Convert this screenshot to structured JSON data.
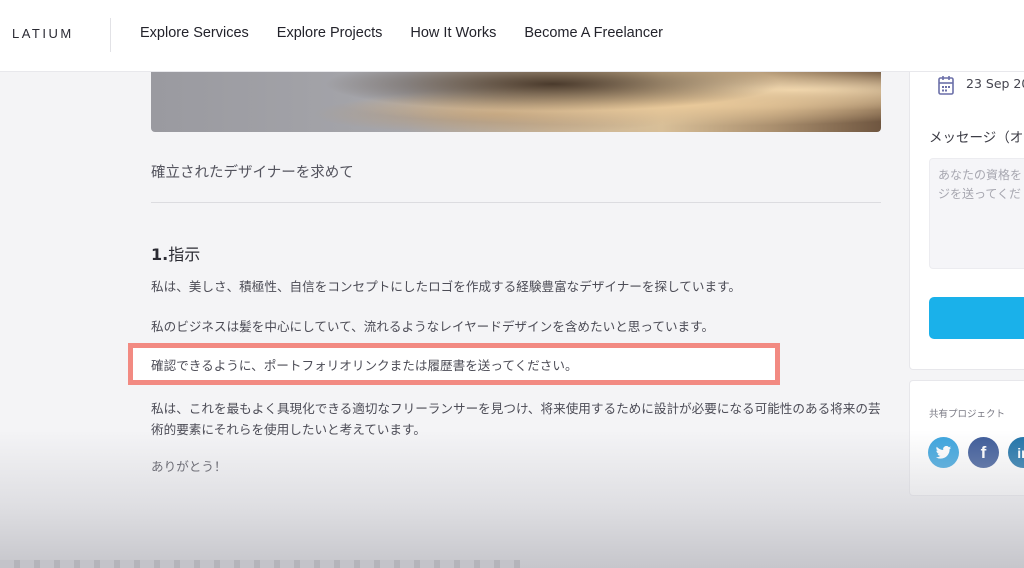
{
  "header": {
    "logo": "LATIUM",
    "nav": [
      {
        "label": "Explore Services"
      },
      {
        "label": "Explore Projects"
      },
      {
        "label": "How It Works"
      },
      {
        "label": "Become A Freelancer"
      }
    ]
  },
  "project": {
    "subtitle": "確立されたデザイナーを求めて",
    "section_number": "1.",
    "section_title": "指示",
    "paragraphs": [
      "私は、美しさ、積極性、自信をコンセプトにしたロゴを作成する経験豊富なデザイナーを探しています。",
      "私のビジネスは髪を中心にしていて、流れるようなレイヤードデザインを含めたいと思っています。",
      "確認できるように、ポートフォリオリンクまたは履歴書を送ってください。",
      "私は、これを最もよく具現化できる適切なフリーランサーを見つけ、将来使用するために設計が必要になる可能性のある将来の芸術的要素にそれらを使用したいと考えています。",
      "ありがとう！"
    ]
  },
  "sidebar": {
    "date": "23 Sep 20",
    "message_label": "メッセージ（オ",
    "message_placeholder": "あなたの資格を\nジを送ってくだ",
    "share_label": "共有プロジェクト",
    "social_icons": [
      "twitter-icon",
      "facebook-icon",
      "linkedin-icon"
    ]
  },
  "colors": {
    "highlight_border": "#f28a82",
    "send_button": "#1ab1ea",
    "twitter": "#3aa4de",
    "facebook": "#3b5998",
    "linkedin": "#1d72a8"
  }
}
